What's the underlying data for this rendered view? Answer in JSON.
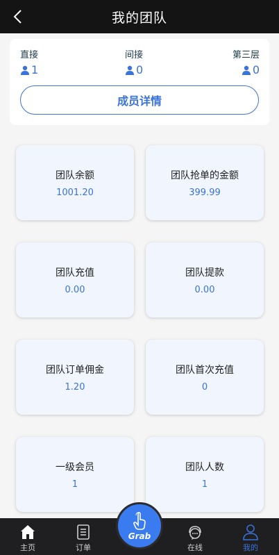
{
  "header": {
    "title": "我的团队"
  },
  "summary": {
    "direct": {
      "label": "直接",
      "value": "1"
    },
    "indirect": {
      "label": "间接",
      "value": "0"
    },
    "third": {
      "label": "第三层",
      "value": "0"
    },
    "detail_button": "成员详情"
  },
  "cards": [
    {
      "label": "团队余额",
      "value": "1001.20"
    },
    {
      "label": "团队抢单的金额",
      "value": "399.99"
    },
    {
      "label": "团队充值",
      "value": "0.00"
    },
    {
      "label": "团队提款",
      "value": "0.00"
    },
    {
      "label": "团队订单佣金",
      "value": "1.20"
    },
    {
      "label": "团队首次充值",
      "value": "0"
    },
    {
      "label": "一级会员",
      "value": "1"
    },
    {
      "label": "团队人数",
      "value": "1"
    }
  ],
  "tabbar": {
    "home": "主页",
    "orders": "订单",
    "grab": "Grab",
    "online": "在线",
    "mine": "我的"
  },
  "colors": {
    "accent": "#3a73d9",
    "header_bg": "#141414",
    "tabbar_bg": "#1f1f22",
    "card_bg": "#f0f5fe"
  }
}
